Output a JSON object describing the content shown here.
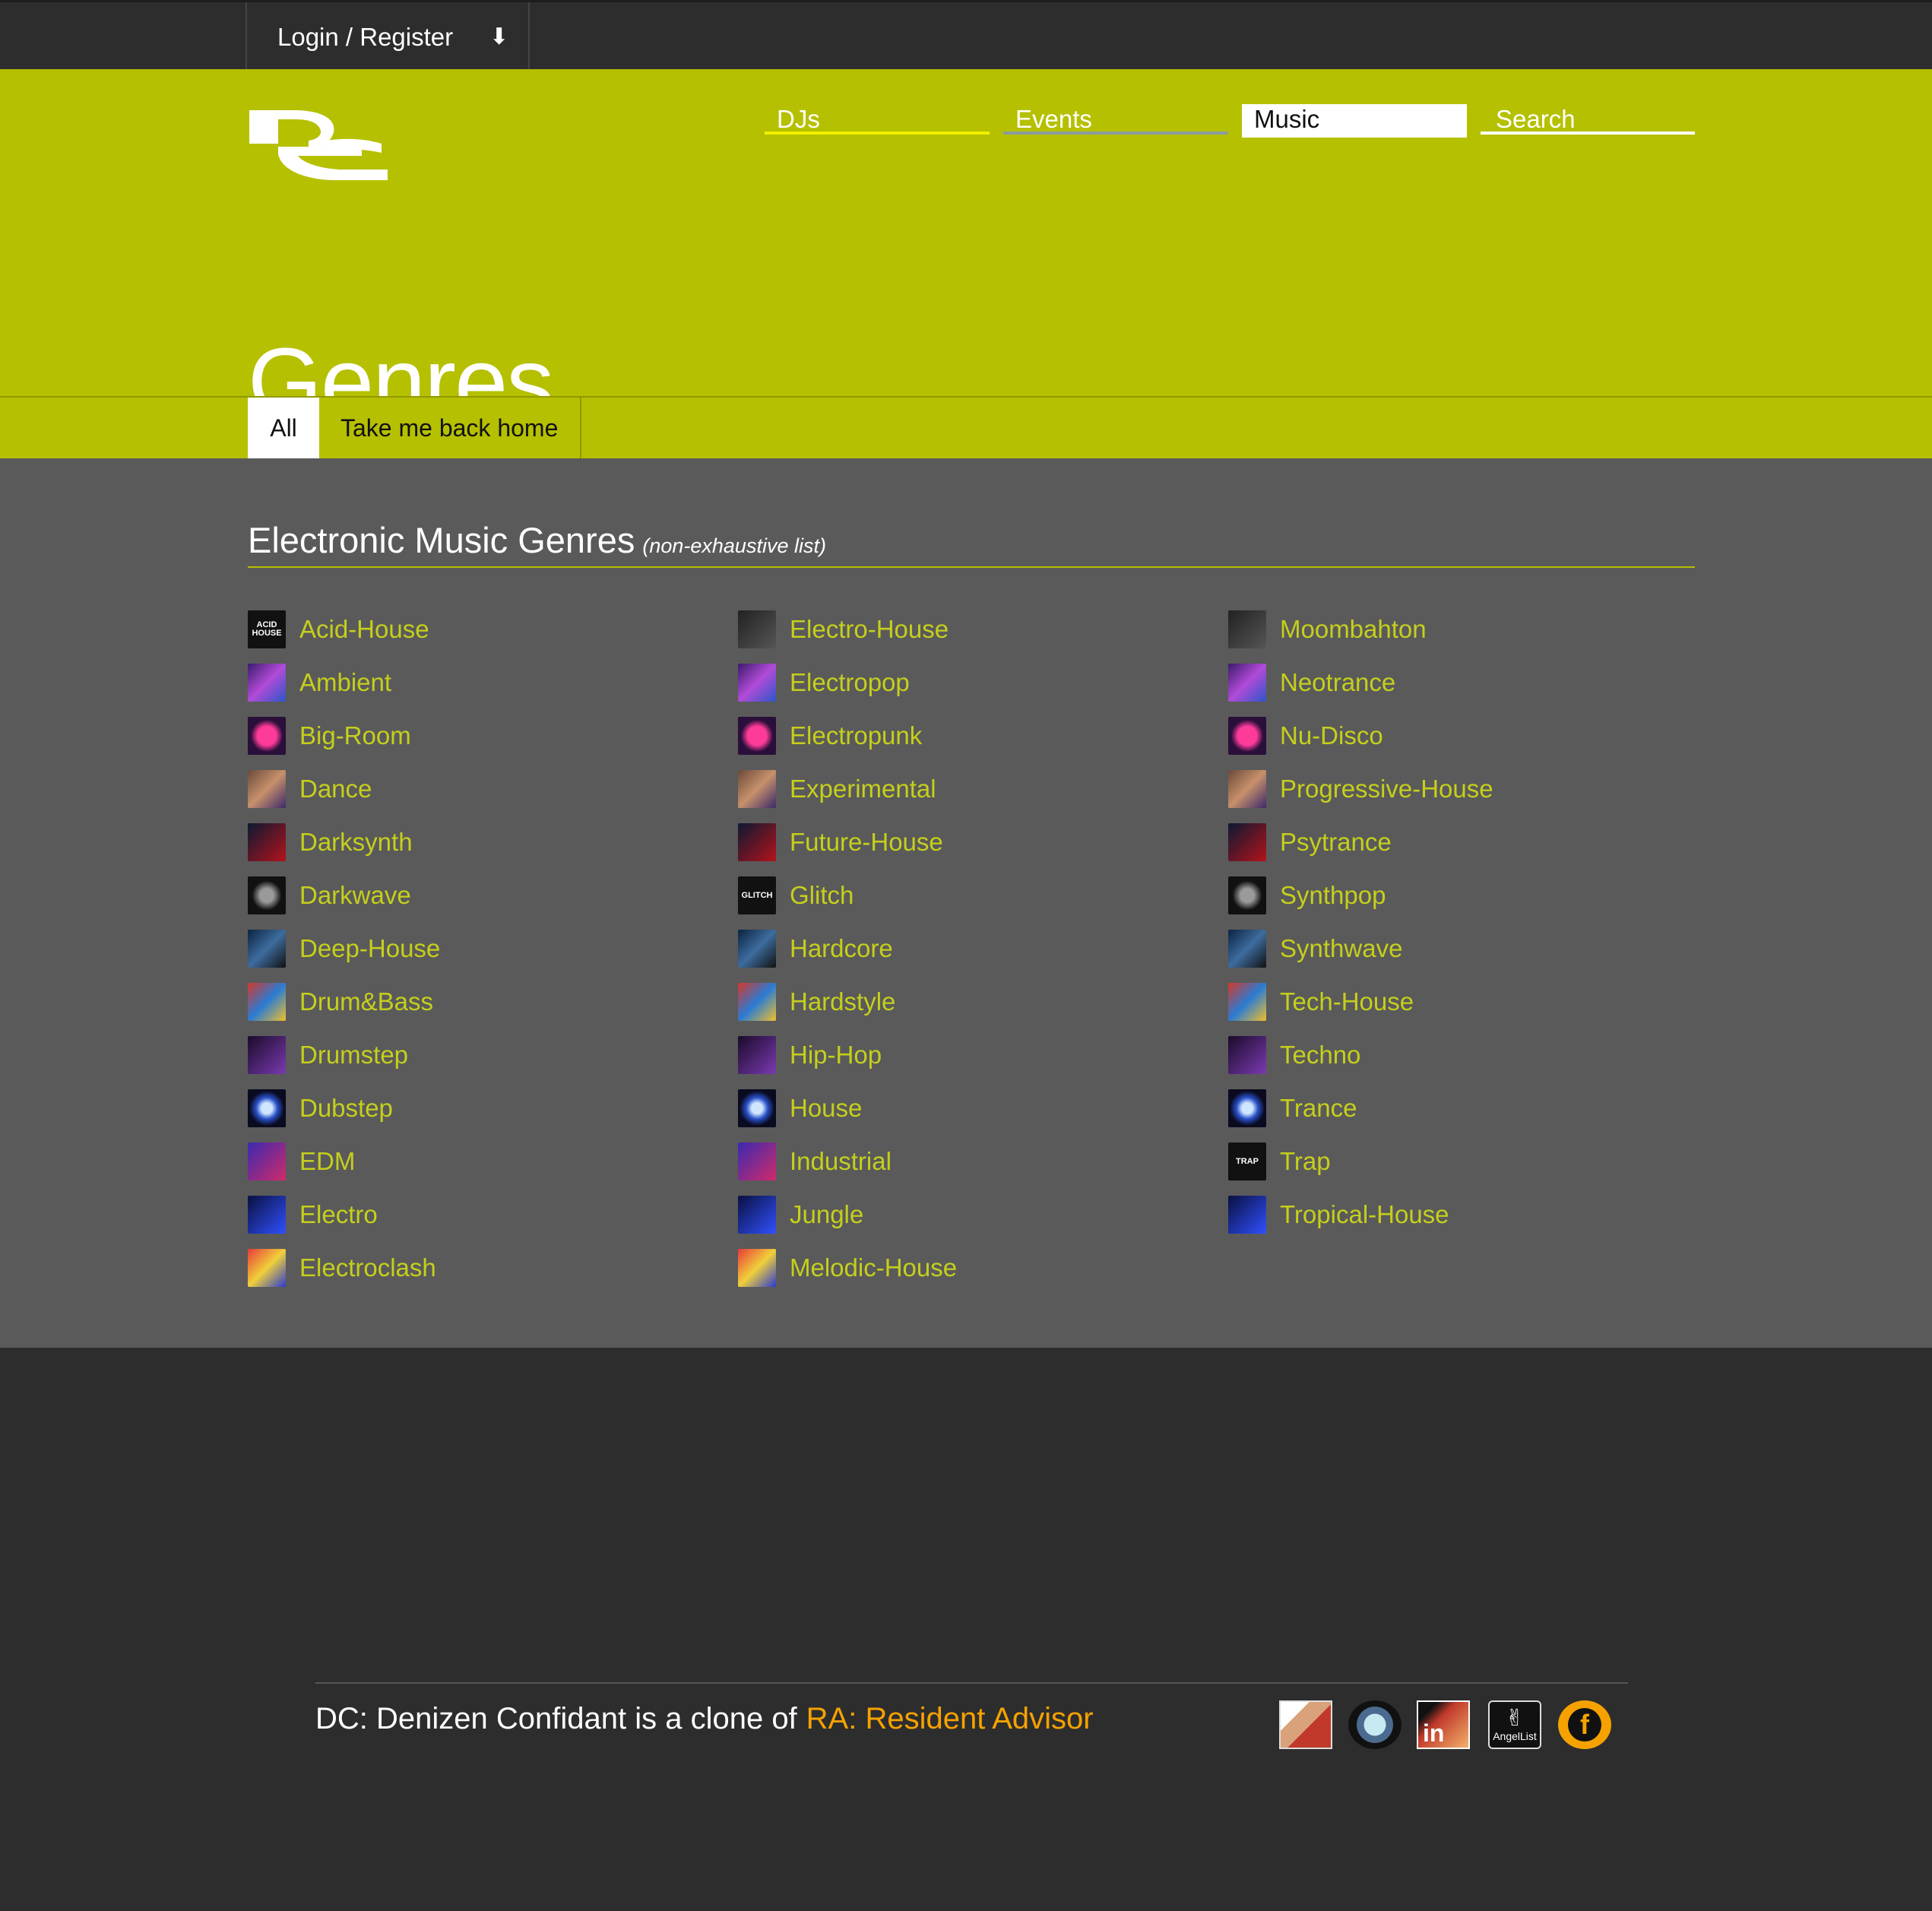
{
  "topbar": {
    "login_label": "Login / Register",
    "login_arrow": "⬇"
  },
  "nav": {
    "djs": "DJs",
    "events": "Events",
    "music": "Music",
    "search": "Search"
  },
  "page_title": "Genres",
  "tabs": {
    "all": "All",
    "home": "Take me back home"
  },
  "section": {
    "title": "Electronic Music Genres",
    "subtitle": "(non-exhaustive list)"
  },
  "genres": {
    "col1": [
      "Acid-House",
      "Ambient",
      "Big-Room",
      "Dance",
      "Darksynth",
      "Darkwave",
      "Deep-House",
      "Drum&Bass",
      "Drumstep",
      "Dubstep",
      "EDM",
      "Electro",
      "Electroclash"
    ],
    "col2": [
      "Electro-House",
      "Electropop",
      "Electropunk",
      "Experimental",
      "Future-House",
      "Glitch",
      "Hardcore",
      "Hardstyle",
      "Hip-Hop",
      "House",
      "Industrial",
      "Jungle",
      "Melodic-House"
    ],
    "col3": [
      "Moombahton",
      "Neotrance",
      "Nu-Disco",
      "Progressive-House",
      "Psytrance",
      "Synthpop",
      "Synthwave",
      "Tech-House",
      "Techno",
      "Trance",
      "Trap",
      "Tropical-House"
    ]
  },
  "thumb_text": {
    "acid_house": "ACID HOUSE",
    "glitch": "GLITCH",
    "trap": "TRAP"
  },
  "footer": {
    "text": "DC: Denizen Confidant is a clone of",
    "link": "RA: Resident Advisor",
    "social": [
      "profile-photo",
      "globe-icon",
      "linkedin-icon",
      "angellist-icon",
      "facebook-icon"
    ],
    "linkedin_text": "in",
    "angellist_glyph": "✌",
    "angellist_text": "AngelList",
    "facebook_text": "f"
  },
  "colors": {
    "header_bg": "#b5c000",
    "main_bg": "#5a5a5a",
    "page_bg": "#2d2d2d",
    "genre_link": "#c5cf1c",
    "footer_link": "#f5a200"
  }
}
